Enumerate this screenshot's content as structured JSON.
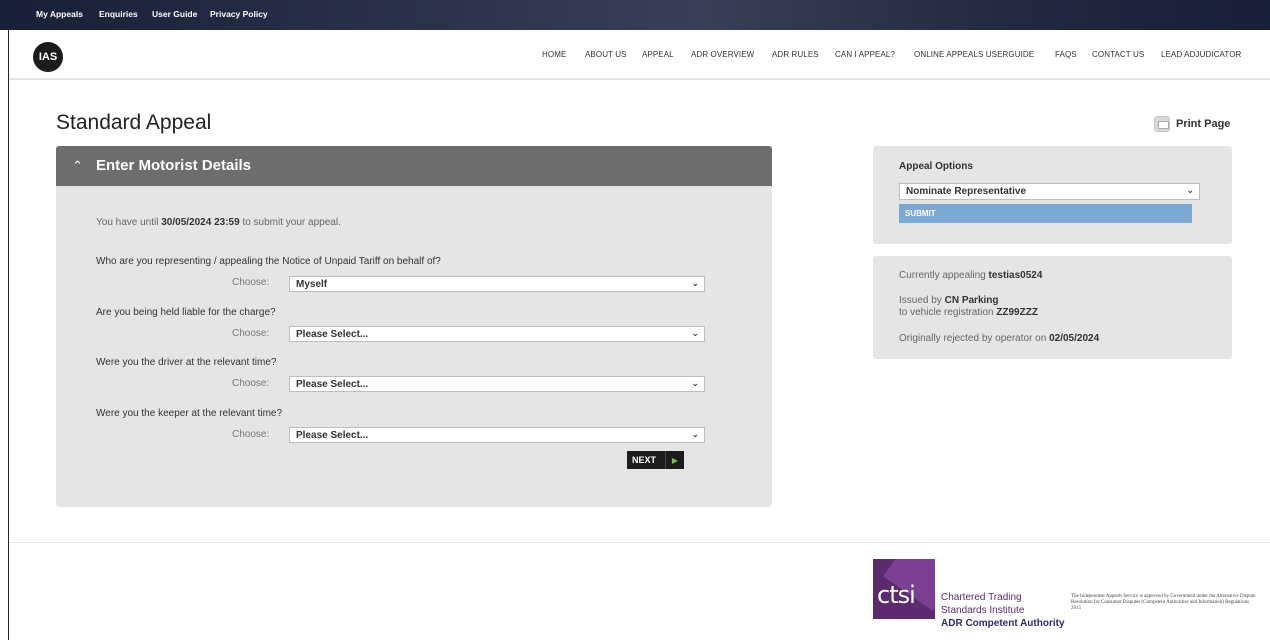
{
  "topbar": {
    "links": [
      "My Appeals",
      "Enquiries",
      "User Guide",
      "Privacy Policy"
    ]
  },
  "header": {
    "logo": "IAS",
    "nav": [
      "HOME",
      "ABOUT US",
      "APPEAL",
      "ADR OVERVIEW",
      "ADR RULES",
      "CAN I APPEAL?",
      "ONLINE APPEALS USERGUIDE",
      "FAQS",
      "CONTACT US",
      "LEAD ADJUDICATOR"
    ]
  },
  "page": {
    "title": "Standard Appeal",
    "print_label": "Print Page"
  },
  "form": {
    "panel_title": "Enter Motorist Details",
    "deadline_prefix": "You have until",
    "deadline_value": "30/05/2024 23:59",
    "deadline_suffix": "to submit your appeal.",
    "choose_label": "Choose:",
    "questions": [
      {
        "text": "Who are you representing / appealing the Notice of Unpaid Tariff on behalf of?",
        "selected": "Myself"
      },
      {
        "text": "Are you being held liable for the charge?",
        "selected": "Please Select..."
      },
      {
        "text": "Were you the driver at the relevant time?",
        "selected": "Please Select..."
      },
      {
        "text": "Were you the keeper at the relevant time?",
        "selected": "Please Select..."
      }
    ],
    "next_label": "NEXT"
  },
  "appeal_options": {
    "title": "Appeal Options",
    "selected": "Nominate Representative",
    "submit_label": "SUBMIT"
  },
  "appeal_info": {
    "appealing_label": "Currently appealing",
    "appealing_value": "testias0524",
    "issued_label": "Issued by",
    "issued_value": "CN Parking",
    "vehicle_label": "to vehicle registration",
    "vehicle_value": "ZZ99ZZZ",
    "rejected_label": "Originally rejected by operator on",
    "rejected_value": "02/05/2024"
  },
  "footer": {
    "ctsi_logo": "ctsi",
    "ctsi_line1": "Chartered Trading",
    "ctsi_line2": "Standards Institute",
    "ctsi_line3": "ADR Competent Authority",
    "legal_text": "The Independent Appeals Service is approved by Government under the Alternative Dispute Resolution for Consumer Disputes (Competent Authorities and Information) Regulations 2015"
  },
  "colors": {
    "topbar": "#23283f",
    "panel_header": "#6d6d6d",
    "panel_bg": "#e5e5e5",
    "submit": "#7ea8d4",
    "next_button": "#1c1c1c",
    "ctsi_purple": "#5b2b6e"
  },
  "icons": {
    "panel_toggle": "chevron-up-icon",
    "print": "printer-icon",
    "next": "play-arrow-icon",
    "select": "chevron-down-icon"
  }
}
